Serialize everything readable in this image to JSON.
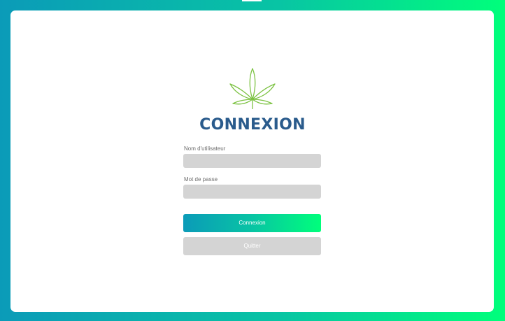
{
  "login": {
    "title": "CONNEXION",
    "username_label": "Nom d'utilisateur",
    "username_value": "",
    "password_label": "Mot de passe",
    "password_value": "",
    "login_button": "Connexion",
    "quit_button": "Quitter"
  },
  "logo": {
    "icon": "cannabis-leaf-icon",
    "color": "#7cc242"
  },
  "colors": {
    "gradient_start": "#0b9bb8",
    "gradient_end": "#00ff7b",
    "title": "#2a5b8c",
    "field_bg": "#d4d4d4"
  }
}
